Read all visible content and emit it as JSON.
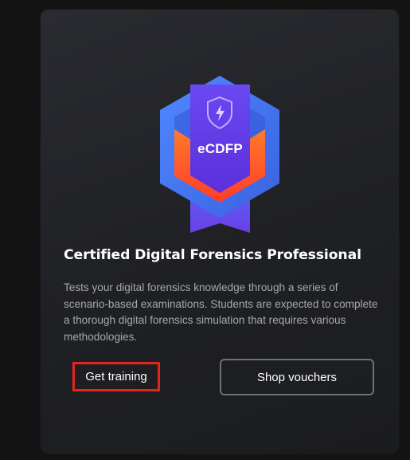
{
  "certification": {
    "badge_text": "eCDFP",
    "title": "Certified Digital Forensics Professional",
    "description": "Tests your digital forensics knowledge through a series of scenario-based examinations. Students are expected to complete a thorough digital forensics simulation that requires various methodologies.",
    "icon": "shield-lightning-icon"
  },
  "actions": {
    "get_training_label": "Get training",
    "shop_vouchers_label": "Shop vouchers"
  },
  "colors": {
    "background": "#131314",
    "card": "#25262a",
    "highlight_border": "#e3261d",
    "secondary_border": "#6f7078",
    "badge_blue": "#4d7cf4",
    "badge_purple": "#6a3ff0",
    "badge_orange": "#ff5b2b"
  }
}
